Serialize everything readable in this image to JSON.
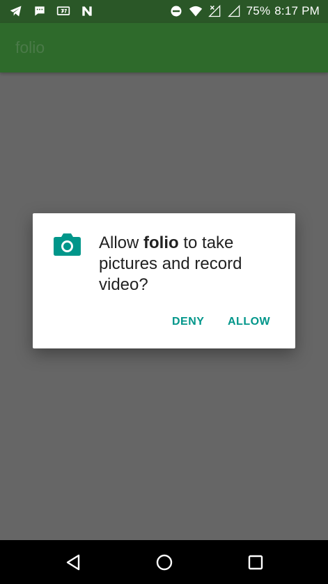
{
  "status_bar": {
    "battery": "75%",
    "time": "8:17 PM",
    "left_icons": [
      "telegram-icon",
      "message-icon",
      "tv-icon",
      "n-icon"
    ],
    "right_icons": [
      "dnd-icon",
      "wifi-icon",
      "signal-x-icon",
      "signal-icon"
    ]
  },
  "app_bar": {
    "title": "folio",
    "color": "#2e6a2b"
  },
  "dialog": {
    "icon": "camera-icon",
    "message_prefix": "Allow ",
    "app_name": "folio",
    "message_suffix": " to take pictures and record video?",
    "deny_label": "DENY",
    "allow_label": "ALLOW",
    "accent_color": "#00968a"
  },
  "nav_bar": {
    "icons": [
      "back-icon",
      "home-icon",
      "recents-icon"
    ]
  }
}
